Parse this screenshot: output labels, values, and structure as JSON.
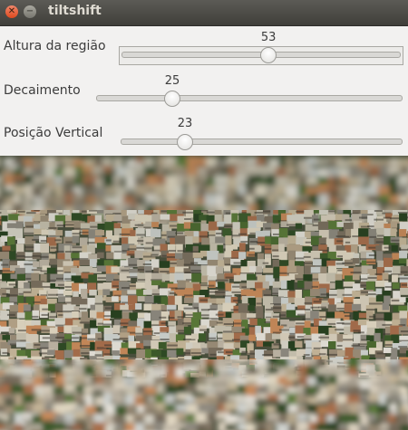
{
  "window": {
    "title": "tiltshift"
  },
  "icons": {
    "close": "close-icon",
    "minimize": "minimize-icon"
  },
  "sliders": [
    {
      "label": "Altura da região",
      "value": "53",
      "fraction": 0.53
    },
    {
      "label": "Decaimento",
      "value": "25",
      "fraction": 0.25
    },
    {
      "label": "Posição Vertical",
      "value": "23",
      "fraction": 0.23
    }
  ],
  "colors": {
    "titlebar": "#3f3e3a",
    "close": "#df4a1f",
    "panel": "#f2f1f0"
  }
}
